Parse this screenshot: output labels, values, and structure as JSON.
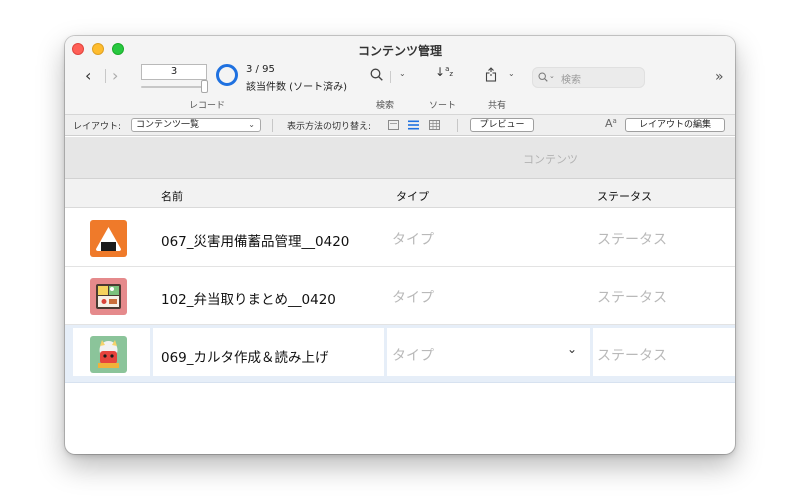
{
  "window": {
    "title": "コンテンツ管理"
  },
  "toolbar": {
    "record": {
      "value": "3",
      "count": "3 / 95",
      "found": "該当件数 (ソート済み)",
      "label": "レコード"
    },
    "search_label": "検索",
    "sort_label": "ソート",
    "share_label": "共有",
    "search_field": {
      "placeholder": "検索"
    },
    "overflow_glyph": "»",
    "accent": "#1f71e0"
  },
  "layout_bar": {
    "layout_label": "レイアウト:",
    "layout_selected": "コンテンツ一覧",
    "view_label": "表示方法の切り替え:",
    "preview_button": "プレビュー",
    "edit_layout_button": "レイアウトの編集"
  },
  "content": {
    "header_title": "コンテンツ",
    "columns": [
      "名前",
      "タイプ",
      "ステータス"
    ],
    "rows": [
      {
        "name": "067_災害用備蓄品管理__0420",
        "type": "タイプ",
        "status": "ステータス",
        "icon": "onigiri-icon",
        "icon_bg": "#ef7a2a"
      },
      {
        "name": "102_弁当取りまとめ__0420",
        "type": "タイプ",
        "status": "ステータス",
        "icon": "bento-icon",
        "icon_bg": "#e58a8c"
      },
      {
        "name": "069_カルタ作成＆読み上げ",
        "type": "タイプ",
        "status": "ステータス",
        "icon": "oni-icon",
        "icon_bg": "#8bc49a"
      }
    ]
  }
}
